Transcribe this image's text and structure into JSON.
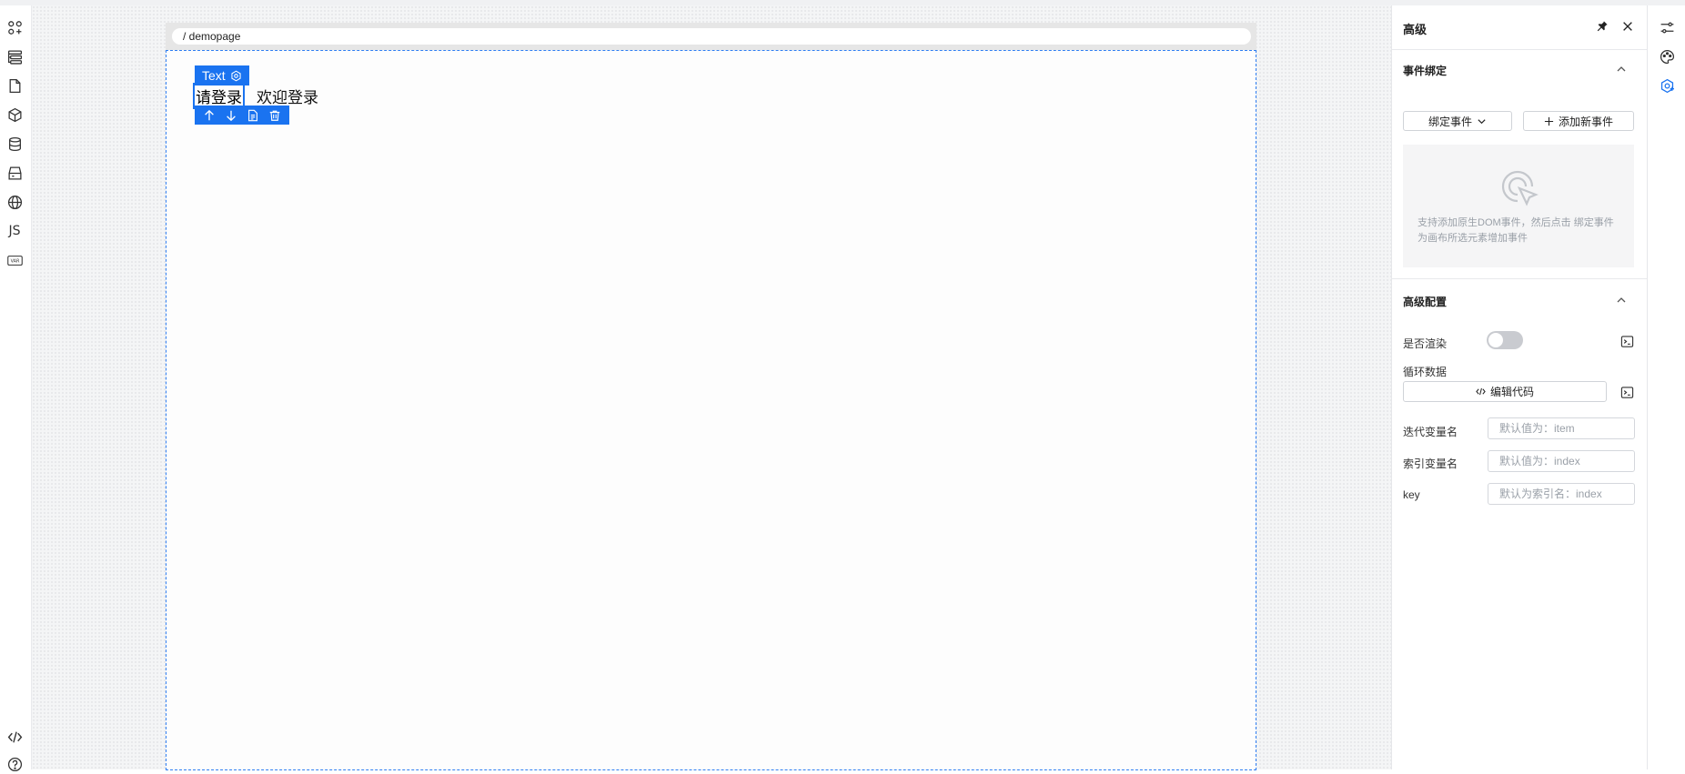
{
  "leftbar": {
    "js_label": "JS",
    "var_label": "VAR",
    "items": [
      "components-icon",
      "outline-icon",
      "page-icon",
      "block-icon",
      "datasource-icon",
      "storage-icon",
      "globe-icon",
      "js-icon",
      "var-icon"
    ],
    "bottom_items": [
      "code-icon",
      "help-icon"
    ]
  },
  "canvas": {
    "breadcrumb": "/ demopage",
    "selected_component": "Text",
    "text_selected": "请登录",
    "text_other": "欢迎登录"
  },
  "panel": {
    "title": "高级",
    "events_section": {
      "title": "事件绑定",
      "bind_event_button": "绑定事件",
      "add_event_button": "添加新事件",
      "empty_text": "支持添加原生DOM事件，然后点击 绑定事件 为画布所选元素增加事件"
    },
    "advanced_section": {
      "title": "高级配置",
      "render_label": "是否渲染",
      "render_enabled": false,
      "loop_label": "循环数据",
      "edit_code_button": "编辑代码",
      "iter_var_label": "迭代变量名",
      "iter_var_placeholder": "默认值为：item",
      "index_var_label": "索引变量名",
      "index_var_placeholder": "默认值为：index",
      "key_label": "key",
      "key_placeholder": "默认为索引名：index"
    }
  },
  "colors": {
    "accent": "#1a73f0",
    "panel_bg": "#ffffff",
    "empty_box": "#f5f5f6"
  }
}
